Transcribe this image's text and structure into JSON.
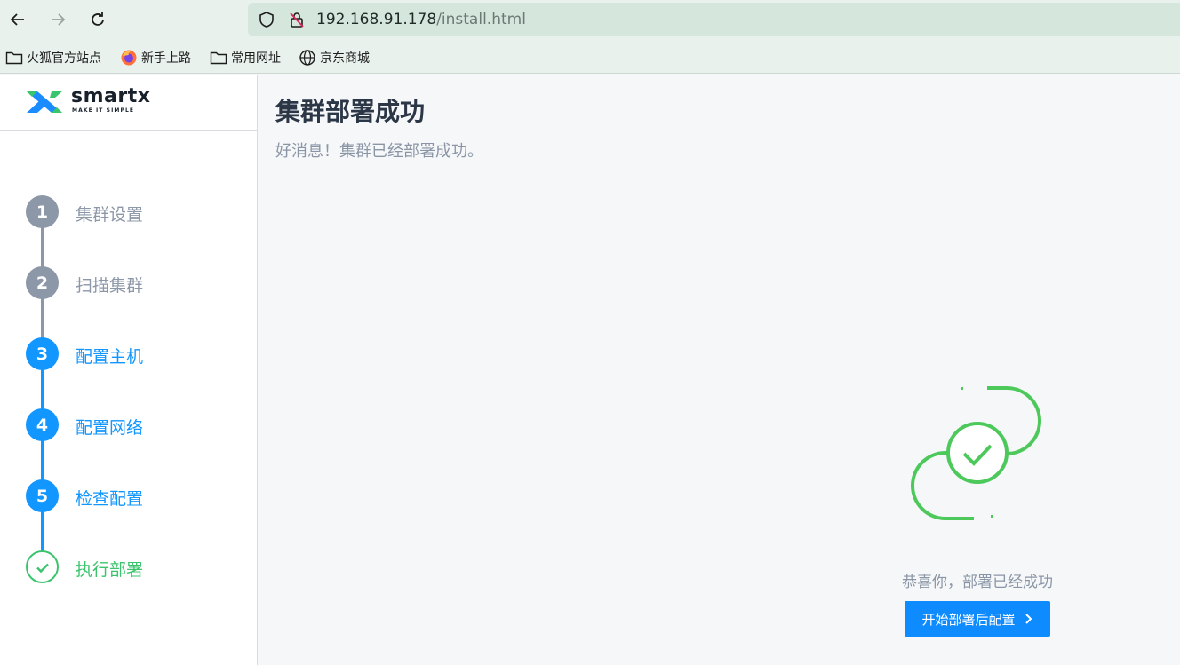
{
  "browser": {
    "url_host": "192.168.91.178",
    "url_path": "/install.html",
    "bookmarks": [
      {
        "label": "火狐官方站点",
        "icon": "folder-icon"
      },
      {
        "label": "新手上路",
        "icon": "firefox-icon"
      },
      {
        "label": "常用网址",
        "icon": "folder-icon"
      },
      {
        "label": "京东商城",
        "icon": "globe-icon"
      }
    ]
  },
  "brand": {
    "name": "smartx",
    "tagline": "MAKE IT SIMPLE",
    "colors": {
      "green": "#39c56b",
      "blue": "#1a8cff"
    }
  },
  "steps": [
    {
      "number": "1",
      "label": "集群设置",
      "state": "done"
    },
    {
      "number": "2",
      "label": "扫描集群",
      "state": "done"
    },
    {
      "number": "3",
      "label": "配置主机",
      "state": "active"
    },
    {
      "number": "4",
      "label": "配置网络",
      "state": "active"
    },
    {
      "number": "5",
      "label": "检查配置",
      "state": "active"
    },
    {
      "number": "",
      "label": "执行部署",
      "state": "success",
      "icon": "check-icon"
    }
  ],
  "colors": {
    "done": "#8c97a8",
    "active": "#1296ff",
    "success": "#3bc46d",
    "primary_button": "#0d8bff"
  },
  "main": {
    "title": "集群部署成功",
    "subtitle": "好消息！集群已经部署成功。",
    "message": "恭喜你，部署已经成功",
    "button_label": "开始部署后配置"
  }
}
